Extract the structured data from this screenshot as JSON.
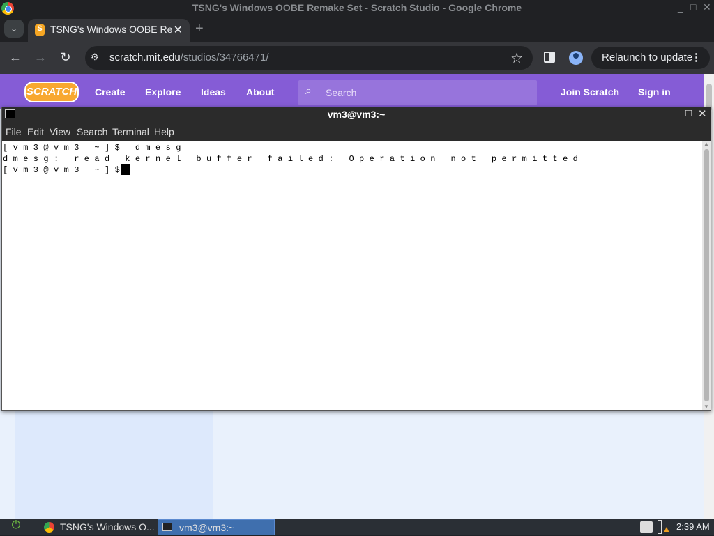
{
  "browser": {
    "window_title": "TSNG's Windows OOBE Remake Set - Scratch Studio - Google Chrome",
    "tab_title": "TSNG's Windows OOBE Remake Set - Scratch Studio",
    "tab_favicon": "S",
    "url_host": "scratch.mit.edu",
    "url_path": "/studios/34766471/",
    "relaunch_label": "Relaunch to update",
    "minimize": "_",
    "maximize": "□",
    "close": "✕"
  },
  "scratch": {
    "logo": "SCRATCH",
    "nav": [
      "Create",
      "Explore",
      "Ideas",
      "About"
    ],
    "search_placeholder": "Search",
    "join": "Join Scratch",
    "signin": "Sign in",
    "accent": "#855cd6"
  },
  "terminal": {
    "title": "vm3@vm3:~",
    "menu": [
      "File",
      "Edit",
      "View",
      "Search",
      "Terminal",
      "Help"
    ],
    "lines": [
      "[vm3@vm3 ~]$ dmesg",
      "dmesg: read kernel buffer failed: Operation not permitted",
      "[vm3@vm3 ~]$ "
    ]
  },
  "taskbar": {
    "chrome_task": "TSNG's Windows O...",
    "terminal_task": "vm3@vm3:~",
    "clock": "2:39 AM"
  }
}
